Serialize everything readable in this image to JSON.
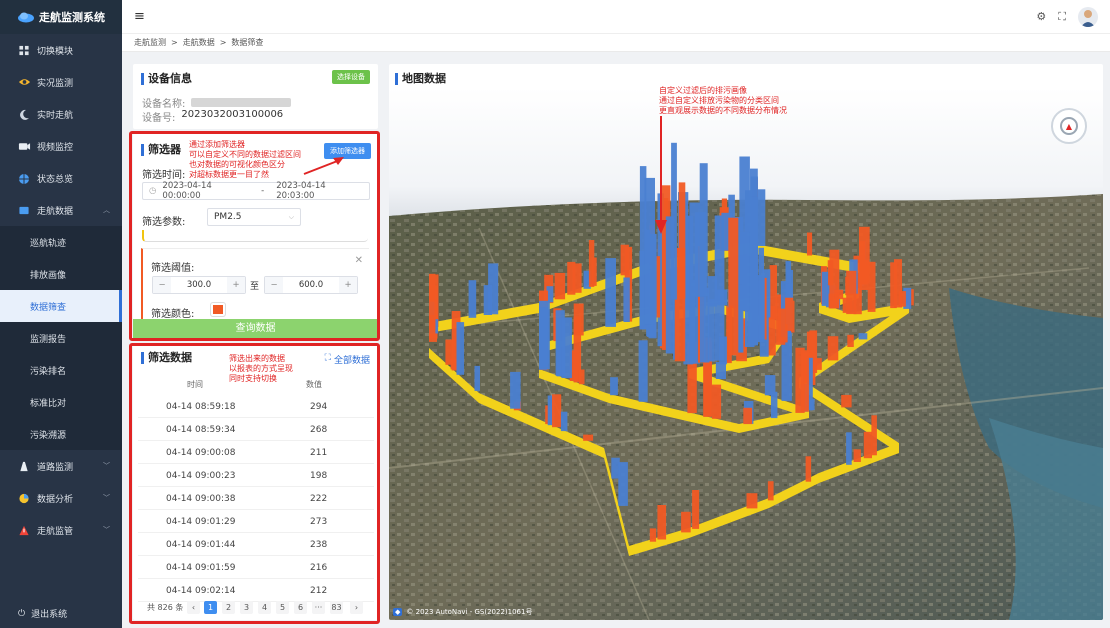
{
  "app": {
    "title": "走航监测系统"
  },
  "sidebar": {
    "items": [
      {
        "label": "切换模块",
        "icon": "grid-icon",
        "type": "item"
      },
      {
        "label": "实况监测",
        "icon": "eye-icon",
        "type": "item"
      },
      {
        "label": "实时走航",
        "icon": "moon-icon",
        "type": "item"
      },
      {
        "label": "视频监控",
        "icon": "camera-icon",
        "type": "item"
      },
      {
        "label": "状态总览",
        "icon": "globe-icon",
        "type": "item"
      },
      {
        "label": "走航数据",
        "icon": "data-icon",
        "type": "group"
      },
      {
        "label": "巡航轨迹",
        "icon": "",
        "type": "sub"
      },
      {
        "label": "排放画像",
        "icon": "",
        "type": "sub"
      },
      {
        "label": "数据筛查",
        "icon": "",
        "type": "sub",
        "active": true
      },
      {
        "label": "监测报告",
        "icon": "",
        "type": "sub"
      },
      {
        "label": "污染排名",
        "icon": "",
        "type": "sub"
      },
      {
        "label": "标准比对",
        "icon": "",
        "type": "sub"
      },
      {
        "label": "污染溯源",
        "icon": "",
        "type": "sub"
      },
      {
        "label": "道路监测",
        "icon": "road-icon",
        "type": "group"
      },
      {
        "label": "数据分析",
        "icon": "chart-icon",
        "type": "group"
      },
      {
        "label": "走航监管",
        "icon": "warning-icon",
        "type": "group"
      }
    ],
    "logout": "退出系统"
  },
  "breadcrumb": [
    "走航监测",
    "走航数据",
    "数据筛查"
  ],
  "device": {
    "title": "设备信息",
    "select_btn": "选择设备",
    "name_label": "设备名称:",
    "id_label": "设备号:",
    "id_value": "2023032003100006"
  },
  "filter": {
    "title": "筛选器",
    "add_btn": "添加筛选器",
    "time_label": "筛选时间:",
    "time_start": "2023-04-14 00:00:00",
    "time_sep": "-",
    "time_end": "2023-04-14 20:03:00",
    "param_label": "筛选参数:",
    "param_value": "PM2.5",
    "threshold_label": "筛选阈值:",
    "min_value": "300.0",
    "range_sep": "至",
    "max_value": "600.0",
    "color_label": "筛选颜色:",
    "color_value": "#f15a24",
    "query_btn": "查询数据",
    "annotation": "通过添加筛选器\n可以自定义不同的数据过滤区间\n也对数据的可视化颜色区分\n对超标数据更一目了然"
  },
  "results": {
    "title": "筛选数据",
    "all_btn": "全部数据",
    "col_time": "时间",
    "col_value": "数值",
    "annotation": "筛选出来的数据\n以报表的方式呈现\n同时支持切换",
    "rows": [
      {
        "time": "04-14 08:59:18",
        "value": "294"
      },
      {
        "time": "04-14 08:59:34",
        "value": "268"
      },
      {
        "time": "04-14 09:00:08",
        "value": "211"
      },
      {
        "time": "04-14 09:00:23",
        "value": "198"
      },
      {
        "time": "04-14 09:00:38",
        "value": "222"
      },
      {
        "time": "04-14 09:01:29",
        "value": "273"
      },
      {
        "time": "04-14 09:01:44",
        "value": "238"
      },
      {
        "time": "04-14 09:01:59",
        "value": "216"
      },
      {
        "time": "04-14 09:02:14",
        "value": "212"
      }
    ],
    "total": "共 826 条",
    "pages": [
      "1",
      "2",
      "3",
      "4",
      "5",
      "6",
      "···",
      "83"
    ],
    "current_page": "1"
  },
  "map": {
    "title": "地图数据",
    "annotation": "自定义过滤后的排污画像\n通过自定义排放污染物的分类区间\n更直观展示数据的不同数据分布情况",
    "attribution": "© 2023 AutoNavi - GS(2022)1061号"
  },
  "colors": {
    "accent": "#2f6fd6",
    "highlight": "#e02424",
    "sidebar": "#283446",
    "filter_bar": "#f15a24",
    "normal_bar": "#4a7fd1",
    "route": "#f2d21b"
  }
}
